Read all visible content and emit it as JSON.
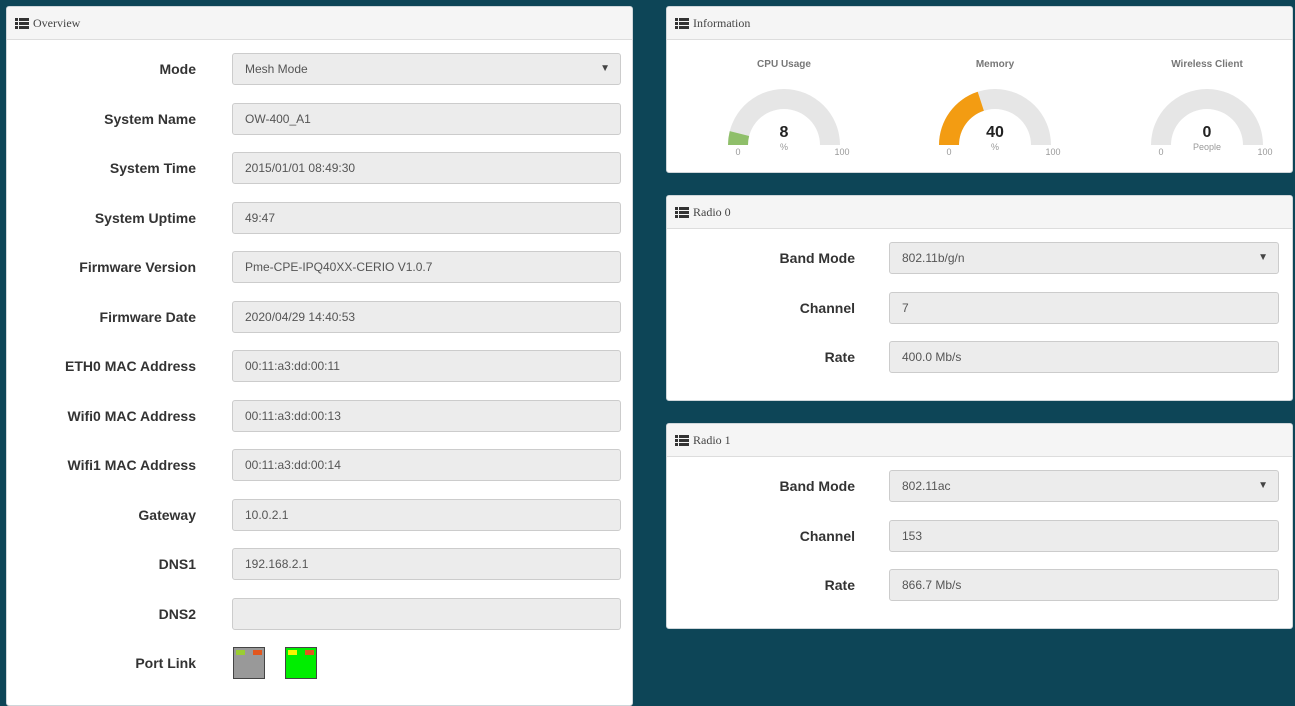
{
  "overview": {
    "title": "Overview",
    "fields": [
      {
        "label": "Mode",
        "value": "Mesh Mode",
        "type": "select"
      },
      {
        "label": "System Name",
        "value": "OW-400_A1",
        "type": "input"
      },
      {
        "label": "System Time",
        "value": "2015/01/01 08:49:30",
        "type": "input"
      },
      {
        "label": "System Uptime",
        "value": "49:47",
        "type": "input"
      },
      {
        "label": "Firmware Version",
        "value": "Pme-CPE-IPQ40XX-CERIO V1.0.7",
        "type": "input"
      },
      {
        "label": "Firmware Date",
        "value": "2020/04/29 14:40:53",
        "type": "input"
      },
      {
        "label": "ETH0 MAC Address",
        "value": "00:11:a3:dd:00:11",
        "type": "input"
      },
      {
        "label": "Wifi0 MAC Address",
        "value": "00:11:a3:dd:00:13",
        "type": "input"
      },
      {
        "label": "Wifi1 MAC Address",
        "value": "00:11:a3:dd:00:14",
        "type": "input"
      },
      {
        "label": "Gateway",
        "value": "10.0.2.1",
        "type": "input"
      },
      {
        "label": "DNS1",
        "value": "192.168.2.1",
        "type": "input"
      },
      {
        "label": "DNS2",
        "value": "",
        "type": "input"
      }
    ],
    "port_link": {
      "label": "Port Link",
      "ports": [
        {
          "status": "inactive",
          "color": "#999999"
        },
        {
          "status": "active",
          "color": "#00ee00"
        }
      ]
    }
  },
  "information": {
    "title": "Information",
    "gauges": [
      {
        "title": "CPU Usage",
        "value": 8,
        "unit": "%",
        "min": "0",
        "max": "100",
        "fraction": 0.08,
        "color": "#8fbf6a"
      },
      {
        "title": "Memory",
        "value": 40,
        "unit": "%",
        "min": "0",
        "max": "100",
        "fraction": 0.4,
        "color": "#f39c12"
      },
      {
        "title": "Wireless Client",
        "value": 0,
        "unit": "People",
        "min": "0",
        "max": "100",
        "fraction": 0.0,
        "color": "#8fbf6a"
      }
    ]
  },
  "radios": [
    {
      "title": "Radio 0",
      "band_label": "Band Mode",
      "band": "802.11b/g/n",
      "channel_label": "Channel",
      "channel": "7",
      "rate_label": "Rate",
      "rate": "400.0 Mb/s"
    },
    {
      "title": "Radio 1",
      "band_label": "Band Mode",
      "band": "802.11ac",
      "channel_label": "Channel",
      "channel": "153",
      "rate_label": "Rate",
      "rate": "866.7 Mb/s"
    }
  ],
  "colors": {
    "background": "#0d4557",
    "gauge_track": "#e6e6e6"
  }
}
